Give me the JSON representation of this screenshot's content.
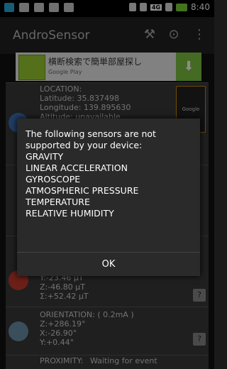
{
  "status_bar": {
    "time": "8:40",
    "network_badge": "4G"
  },
  "app": {
    "title": "AndroSensor"
  },
  "ad": {
    "text": "横断検索で簡単部屋探し",
    "source": "Google Play"
  },
  "sensors_bg": {
    "location": {
      "title": "LOCATION:",
      "latitude": "Latitude:  35.837498",
      "longitude": "Longitude:  139.895630",
      "altitude": "Altitude: unavailable",
      "google": "Google"
    },
    "magnetic": {
      "y": "Y:-23.46 μT",
      "z": "Z:-46.80 μT",
      "total": "Σ:+52.42 μT"
    },
    "orientation": {
      "title": "ORIENTATION: ( 0.2mA )",
      "z": "Z:+286.19°",
      "x": "X:-26.90°",
      "y": "Y:+0.44°"
    },
    "proximity": {
      "title": "PROXIMITY:",
      "value": "Waiting for event"
    }
  },
  "dialog": {
    "message": "The following sensors are not supported by your device:",
    "sensors": [
      "GRAVITY",
      "LINEAR ACCELERATION",
      "GYROSCOPE",
      "ATMOSPHERIC PRESSURE",
      "TEMPERATURE",
      "RELATIVE HUMIDITY"
    ],
    "ok_label": "OK"
  },
  "colors": {
    "accent_green": "#7cc142",
    "dialog_bg": "#2a2a2a"
  }
}
